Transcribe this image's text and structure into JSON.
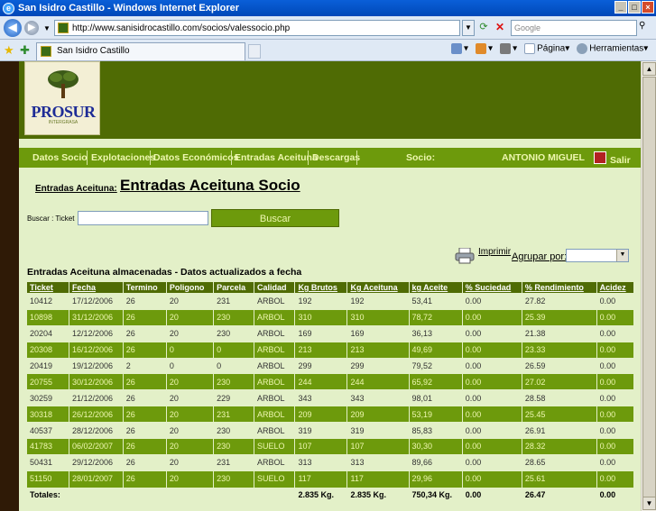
{
  "window": {
    "title": "San Isidro Castillo - Windows Internet Explorer",
    "buttons": {
      "minimize": "_",
      "maximize": "□",
      "close": "×"
    }
  },
  "browser": {
    "url": "http://www.sanisidrocastillo.com/socios/valessocio.php",
    "search_placeholder": "Google",
    "tab_title": "San Isidro Castillo",
    "commands": {
      "home": "",
      "feeds": "",
      "print": "",
      "page": "Página",
      "tools": "Herramientas"
    }
  },
  "site": {
    "logo_text": "PROSUR",
    "logo_sub": "INTERGRASA"
  },
  "menu": {
    "items": [
      "Datos Socio",
      "Explotaciones",
      "Datos Económicos",
      "Entradas Aceituna",
      "Descargas"
    ],
    "socio_label": "Socio:",
    "socio_name": "ANTONIO MIGUEL",
    "salir": "Salir"
  },
  "section": {
    "breadcrumb": "Entradas Aceituna:",
    "title": "Entradas Aceituna Socio"
  },
  "search": {
    "label": "Buscar : Ticket",
    "value": "",
    "button": "Buscar"
  },
  "tools": {
    "imprimir": "Imprimir",
    "agrupar": "Agrupar por:",
    "agrupar_value": ""
  },
  "table": {
    "caption": "Entradas Aceituna almacenadas - Datos actualizados a fecha",
    "headers": [
      "Ticket",
      "Fecha",
      "Termino",
      "Poligono",
      "Parcela",
      "Calidad",
      "Kg Brutos",
      "Kg Aceituna",
      "kg Aceite",
      "% Suciedad",
      "% Rendimiento",
      "Acidez"
    ],
    "rows": [
      [
        "10412",
        "17/12/2006",
        "26",
        "20",
        "231",
        "ARBOL",
        "192",
        "192",
        "53,41",
        "0.00",
        "27.82",
        "0.00"
      ],
      [
        "10898",
        "31/12/2006",
        "26",
        "20",
        "230",
        "ARBOL",
        "310",
        "310",
        "78,72",
        "0.00",
        "25.39",
        "0.00"
      ],
      [
        "20204",
        "12/12/2006",
        "26",
        "20",
        "230",
        "ARBOL",
        "169",
        "169",
        "36,13",
        "0.00",
        "21.38",
        "0.00"
      ],
      [
        "20308",
        "16/12/2006",
        "26",
        "0",
        "0",
        "ARBOL",
        "213",
        "213",
        "49,69",
        "0.00",
        "23.33",
        "0.00"
      ],
      [
        "20419",
        "19/12/2006",
        "2",
        "0",
        "0",
        "ARBOL",
        "299",
        "299",
        "79,52",
        "0.00",
        "26.59",
        "0.00"
      ],
      [
        "20755",
        "30/12/2006",
        "26",
        "20",
        "230",
        "ARBOL",
        "244",
        "244",
        "65,92",
        "0.00",
        "27.02",
        "0.00"
      ],
      [
        "30259",
        "21/12/2006",
        "26",
        "20",
        "229",
        "ARBOL",
        "343",
        "343",
        "98,01",
        "0.00",
        "28.58",
        "0.00"
      ],
      [
        "30318",
        "26/12/2006",
        "26",
        "20",
        "231",
        "ARBOL",
        "209",
        "209",
        "53,19",
        "0.00",
        "25.45",
        "0.00"
      ],
      [
        "40537",
        "28/12/2006",
        "26",
        "20",
        "230",
        "ARBOL",
        "319",
        "319",
        "85,83",
        "0.00",
        "26.91",
        "0.00"
      ],
      [
        "41783",
        "06/02/2007",
        "26",
        "20",
        "230",
        "SUELO",
        "107",
        "107",
        "30,30",
        "0.00",
        "28.32",
        "0.00"
      ],
      [
        "50431",
        "29/12/2006",
        "26",
        "20",
        "231",
        "ARBOL",
        "313",
        "313",
        "89,66",
        "0.00",
        "28.65",
        "0.00"
      ],
      [
        "51150",
        "28/01/2007",
        "26",
        "20",
        "230",
        "SUELO",
        "117",
        "117",
        "29,96",
        "0.00",
        "25.61",
        "0.00"
      ]
    ],
    "totals": [
      "Totales:",
      "",
      "",
      "",
      "",
      "",
      "2.835 Kg.",
      "2.835 Kg.",
      "750,34 Kg.",
      "0.00",
      "26.47",
      "0.00"
    ]
  },
  "colors": {
    "banner": "#4f6b04",
    "menu": "#6d9a0c",
    "page_bg": "#e3f0c8",
    "outer_bg": "#2f1a06"
  }
}
